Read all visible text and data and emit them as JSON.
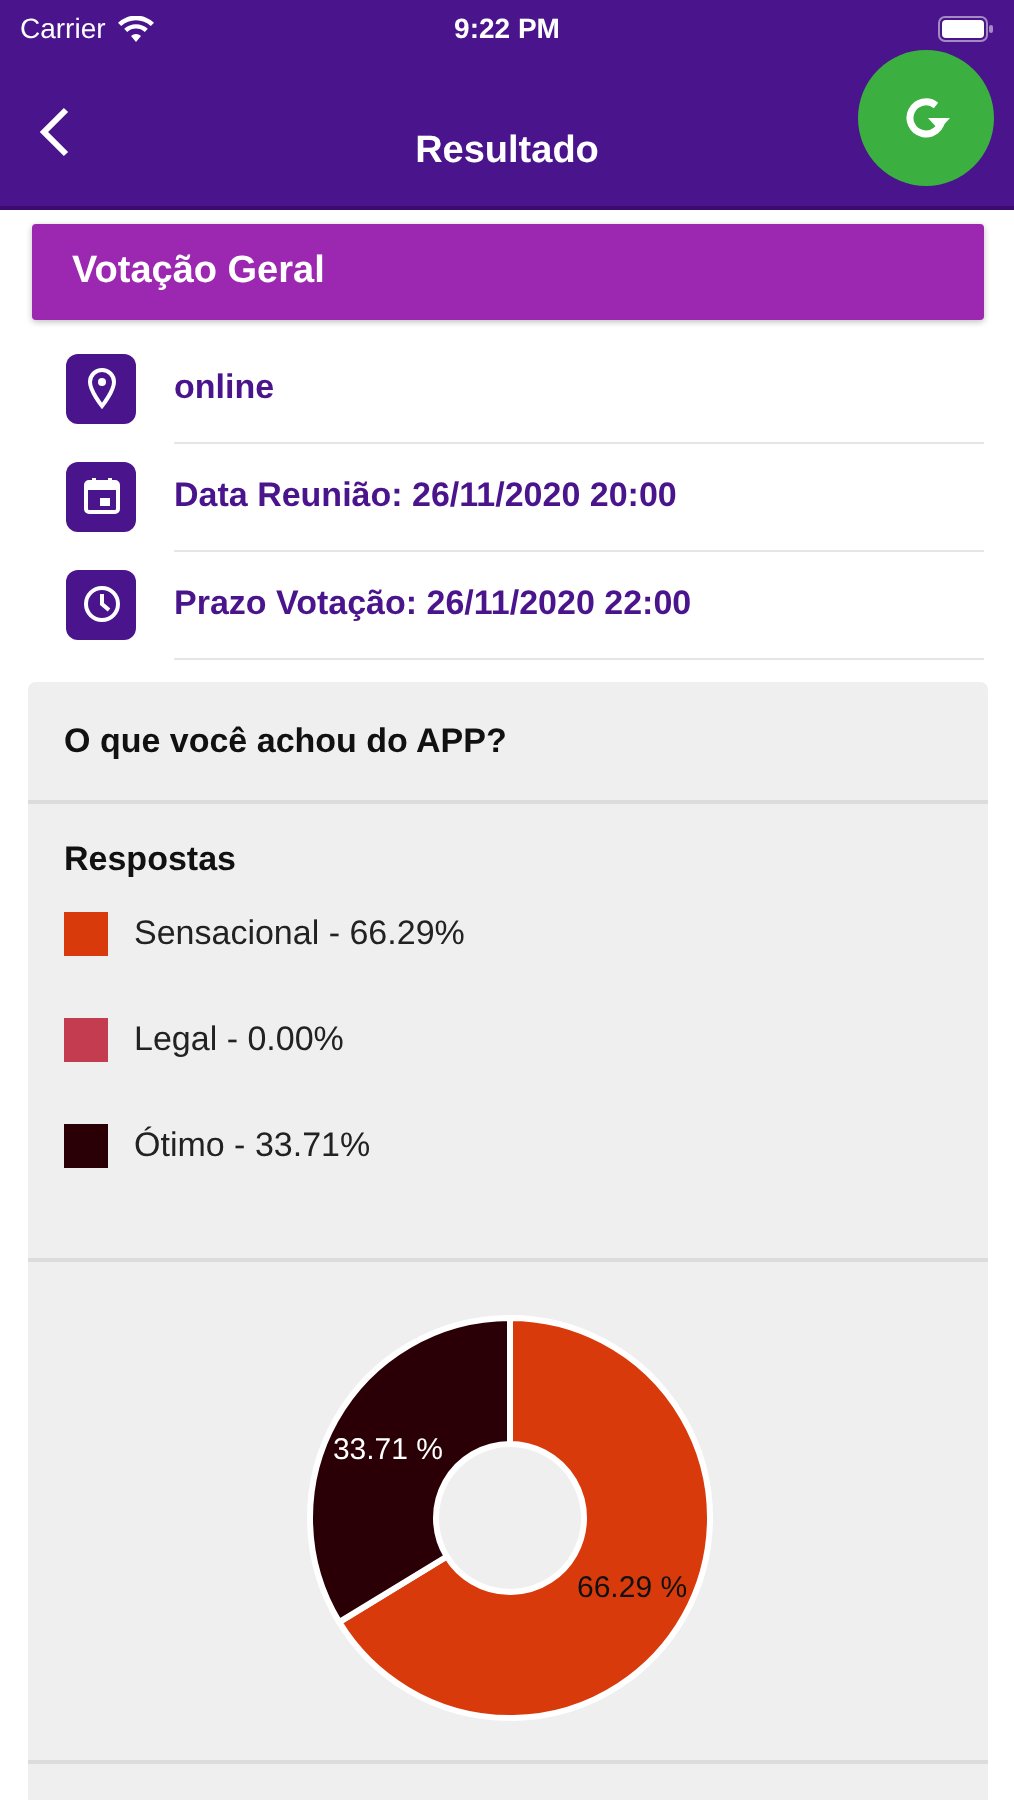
{
  "status_bar": {
    "carrier": "Carrier",
    "time": "9:22 PM"
  },
  "header": {
    "title": "Resultado"
  },
  "meeting": {
    "title": "Votação Geral",
    "details": [
      {
        "kind": "location",
        "text": "online"
      },
      {
        "kind": "date",
        "text": "Data Reunião: 26/11/2020 20:00"
      },
      {
        "kind": "deadline",
        "text": "Prazo Votação: 26/11/2020 22:00"
      }
    ]
  },
  "question": {
    "title": "O que você achou do APP?",
    "answers_heading": "Respostas",
    "answers": [
      {
        "label": "Sensacional - 66.29%",
        "color": "#d83a0c"
      },
      {
        "label": "Legal - 0.00%",
        "color": "#c43c50"
      },
      {
        "label": "Ótimo - 33.71%",
        "color": "#2a0006"
      }
    ],
    "chart_data": {
      "type": "donut",
      "values": [
        66.29,
        0,
        33.71
      ],
      "value_labels": [
        "66.29 %",
        null,
        "33.71 %"
      ]
    }
  }
}
